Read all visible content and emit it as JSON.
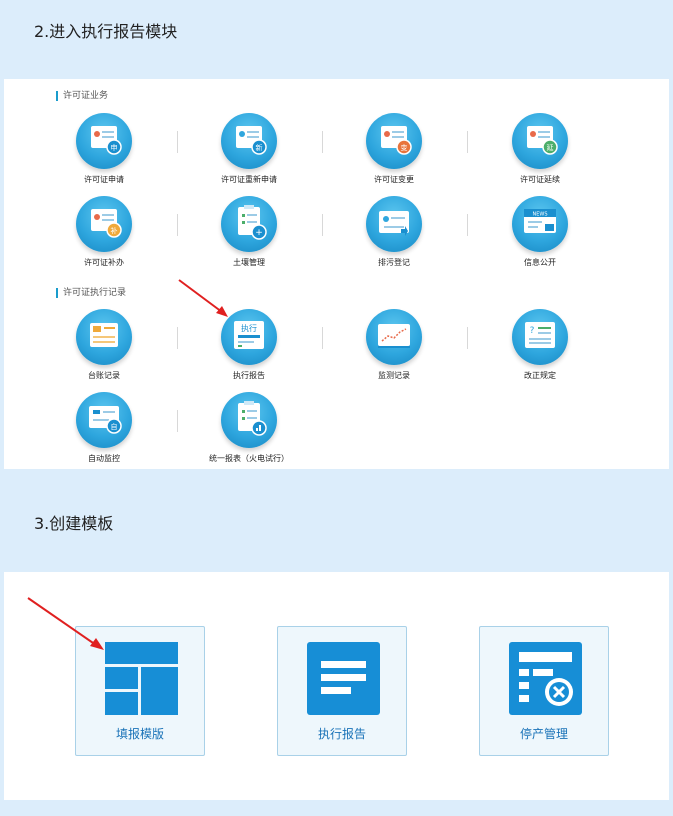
{
  "steps": {
    "step2_title": "2.进入执行报告模块",
    "step3_title": "3.创建模板"
  },
  "license_business": {
    "section_label": "许可证业务",
    "items": [
      {
        "label": "许可证申请",
        "icon": "license-apply-icon",
        "badge": "申"
      },
      {
        "label": "许可证重新申请",
        "icon": "license-reapply-icon",
        "badge": "新"
      },
      {
        "label": "许可证变更",
        "icon": "license-change-icon",
        "badge": "变"
      },
      {
        "label": "许可证延续",
        "icon": "license-renew-icon",
        "badge": "延"
      },
      {
        "label": "许可证补办",
        "icon": "license-reissue-icon",
        "badge": "补"
      },
      {
        "label": "土壤管理",
        "icon": "soil-management-icon",
        "badge": "+"
      },
      {
        "label": "排污登记",
        "icon": "discharge-registration-icon",
        "badge": ""
      },
      {
        "label": "信息公开",
        "icon": "info-disclosure-icon",
        "badge": "NEWS"
      }
    ]
  },
  "execution_records": {
    "section_label": "许可证执行记录",
    "items": [
      {
        "label": "台账记录",
        "icon": "ledger-record-icon"
      },
      {
        "label": "执行报告",
        "icon": "execution-report-icon",
        "badge": "执行"
      },
      {
        "label": "监测记录",
        "icon": "monitoring-record-icon"
      },
      {
        "label": "改正规定",
        "icon": "correction-rule-icon",
        "badge": "?"
      },
      {
        "label": "自动监控",
        "icon": "auto-monitor-icon",
        "badge": "自"
      },
      {
        "label": "统一报表（火电试行）",
        "icon": "unified-report-icon"
      }
    ]
  },
  "templates": {
    "items": [
      {
        "label": "填报模版",
        "icon": "fill-template-icon"
      },
      {
        "label": "执行报告",
        "icon": "execution-report-doc-icon"
      },
      {
        "label": "停产管理",
        "icon": "shutdown-management-icon"
      }
    ]
  },
  "colors": {
    "page_bg": "#dcedfb",
    "icon_blue": "#2ea6de",
    "tile_blue": "#178ed6",
    "arrow_red": "#e02020",
    "label_blue": "#1a73b8"
  }
}
